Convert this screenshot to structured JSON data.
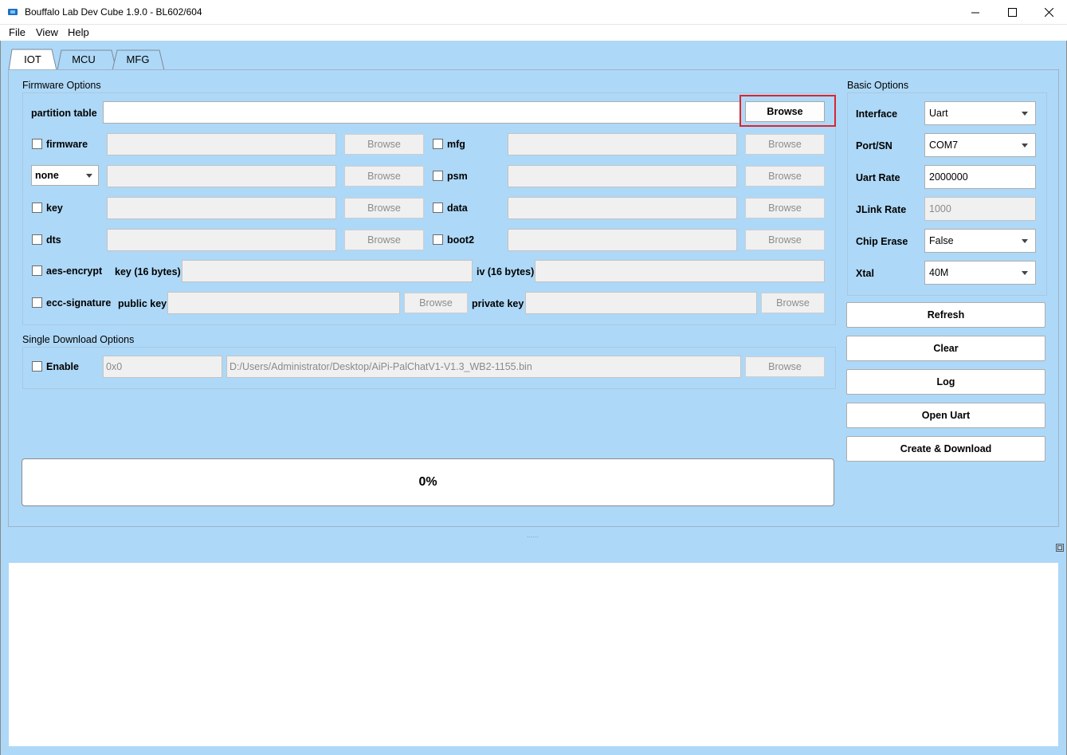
{
  "window": {
    "title": "Bouffalo Lab Dev Cube 1.9.0 - BL602/604"
  },
  "menu": {
    "file": "File",
    "view": "View",
    "help": "Help"
  },
  "tabs": [
    "IOT",
    "MCU",
    "MFG"
  ],
  "firmware": {
    "title": "Firmware Options",
    "partition_table": "partition table",
    "browse": "Browse",
    "firmware": "firmware",
    "mfg": "mfg",
    "none_select": "none",
    "psm": "psm",
    "key": "key",
    "data": "data",
    "dts": "dts",
    "boot2": "boot2",
    "aes_encrypt": "aes-encrypt",
    "key16": "key (16 bytes)",
    "iv16": "iv (16 bytes)",
    "ecc_signature": "ecc-signature",
    "public_key": "public key",
    "private_key": "private key"
  },
  "single": {
    "title": "Single Download Options",
    "enable": "Enable",
    "address": "0x0",
    "path": "D:/Users/Administrator/Desktop/AiPi-PalChatV1-V1.3_WB2-1155.bin",
    "browse": "Browse"
  },
  "progress": {
    "value": "0%"
  },
  "basic": {
    "title": "Basic Options",
    "interface_label": "Interface",
    "interface_value": "Uart",
    "port_label": "Port/SN",
    "port_value": "COM7",
    "uart_rate_label": "Uart Rate",
    "uart_rate_value": "2000000",
    "jlink_rate_label": "JLink Rate",
    "jlink_rate_value": "1000",
    "chip_erase_label": "Chip Erase",
    "chip_erase_value": "False",
    "xtal_label": "Xtal",
    "xtal_value": "40M"
  },
  "actions": {
    "refresh": "Refresh",
    "clear": "Clear",
    "log": "Log",
    "open_uart": "Open Uart",
    "create_download": "Create & Download"
  },
  "splitter": "......"
}
